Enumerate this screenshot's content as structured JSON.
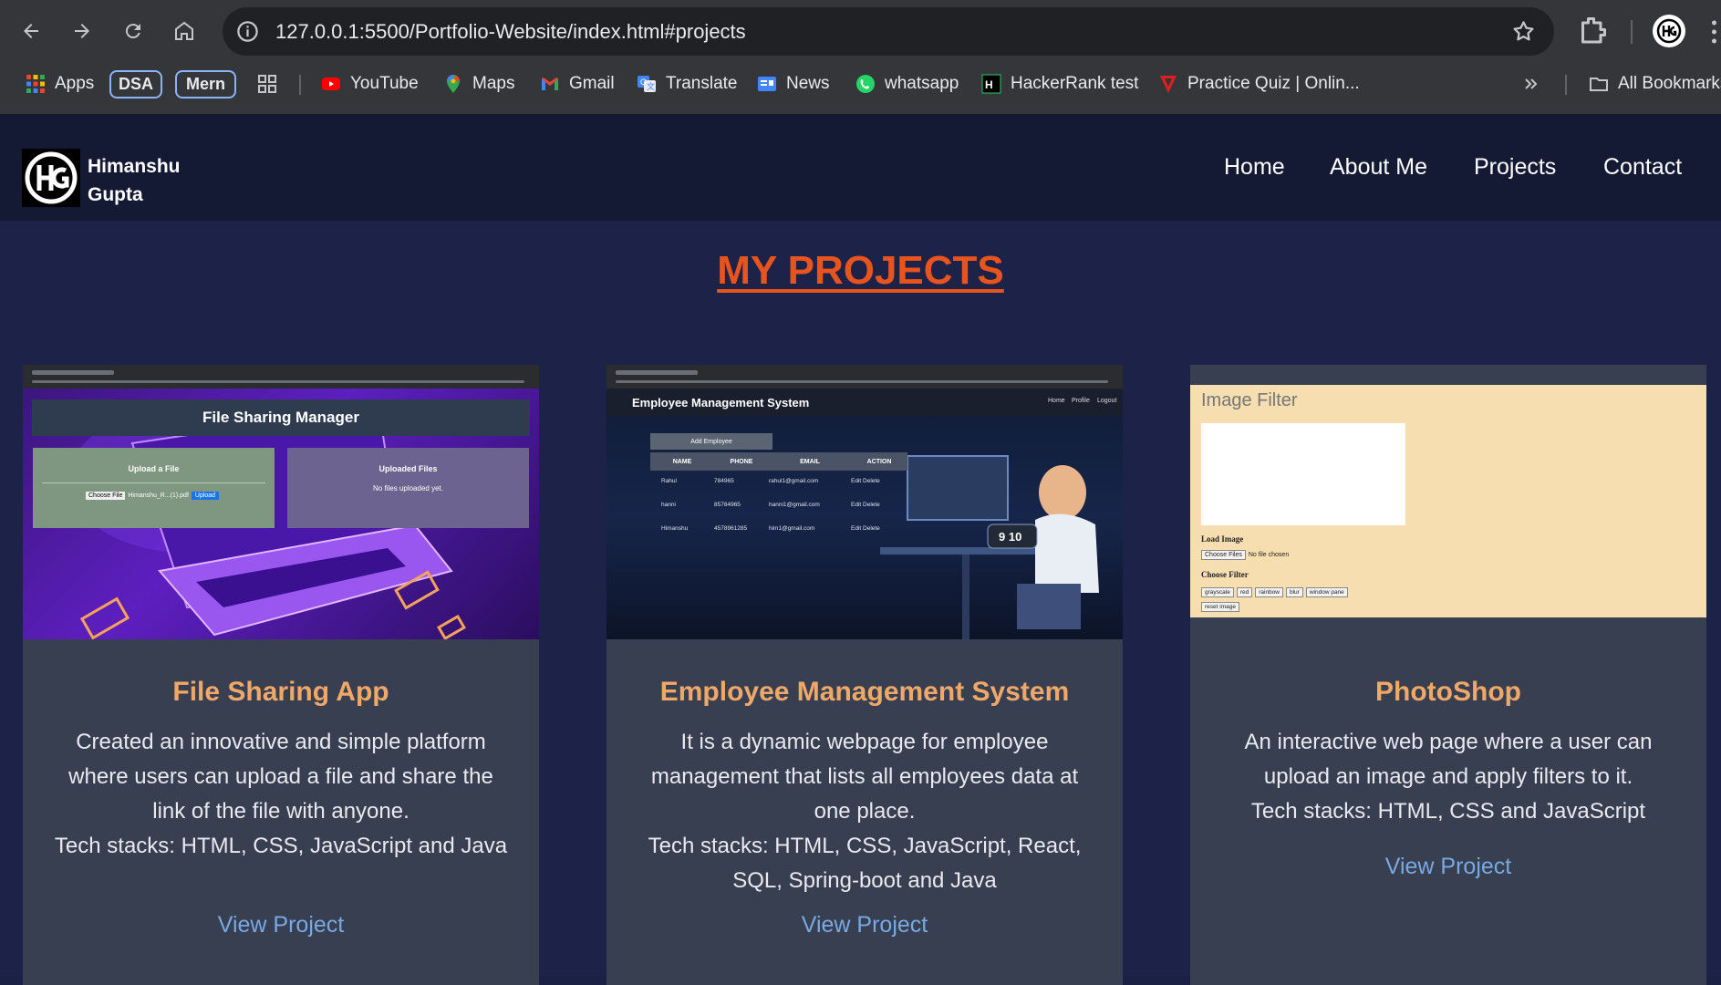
{
  "browser": {
    "url": "127.0.0.1:5500/Portfolio-Website/index.html#projects",
    "bookmarks": [
      {
        "label": "Apps",
        "icon": "apps-grid-icon"
      },
      {
        "label": "DSA",
        "icon": ""
      },
      {
        "label": "Mern",
        "icon": ""
      },
      {
        "label": "",
        "icon": "tab-groups-icon"
      },
      {
        "label": "YouTube",
        "icon": "youtube-icon"
      },
      {
        "label": "Maps",
        "icon": "maps-pin-icon"
      },
      {
        "label": "Gmail",
        "icon": "gmail-icon"
      },
      {
        "label": "Translate",
        "icon": "translate-icon"
      },
      {
        "label": "News",
        "icon": "news-icon"
      },
      {
        "label": "whatsapp",
        "icon": "whatsapp-icon"
      },
      {
        "label": "HackerRank test",
        "icon": "hackerrank-icon"
      },
      {
        "label": "Practice Quiz | Onlin...",
        "icon": "quiz-icon"
      }
    ],
    "all_bookmarks_label": "All Bookmarks"
  },
  "site": {
    "brand_first": "Himanshu",
    "brand_last": "Gupta",
    "nav": [
      "Home",
      "About Me",
      "Projects",
      "Contact"
    ]
  },
  "projects_section": {
    "title": "MY PROJECTS",
    "cards": [
      {
        "title": "File Sharing App",
        "description": "Created an innovative and simple platform where users can upload a file and share the link of the file with anyone.",
        "tech": "Tech stacks: HTML, CSS, JavaScript and Java",
        "link_label": "View Project",
        "thumb": {
          "heading": "File Sharing Manager",
          "upload_title": "Upload a File",
          "choose_label": "Choose File",
          "file_name": "Himanshu_R...(1).pdf",
          "upload_btn": "Upload",
          "uploaded_title": "Uploaded Files",
          "uploaded_empty": "No files uploaded yet."
        }
      },
      {
        "title": "Employee Management System",
        "description": "It is a dynamic webpage for employee management that lists all employees data at one place.",
        "tech": "Tech stacks: HTML, CSS, JavaScript, React, SQL, Spring-boot and Java",
        "link_label": "View Project",
        "thumb": {
          "heading": "Employee Management System",
          "nav": [
            "Home",
            "Profile",
            "Logout"
          ],
          "add_btn": "Add Employee",
          "columns": [
            "NAME",
            "PHONE",
            "EMAIL",
            "ACTION"
          ],
          "rows": [
            [
              "Rahul",
              "784965",
              "rahul1@gmail.com",
              "Edit  Delete"
            ],
            [
              "hanni",
              "85784965",
              "hanni1@gmail.com",
              "Edit  Delete"
            ],
            [
              "Himanshu",
              "4578961285",
              "him1@gmail.com",
              "Edit  Delete"
            ]
          ],
          "clock": "9 10"
        }
      },
      {
        "title": "PhotoShop",
        "description": "An interactive web page where a user can upload an image and apply filters to it.",
        "tech": "Tech stacks: HTML, CSS and JavaScript",
        "link_label": "View Project",
        "thumb": {
          "heading": "Image Filter",
          "load_label": "Load Image",
          "choose_label": "Choose Files",
          "no_file": "No file chosen",
          "filter_label": "Choose Filter",
          "filters": [
            "grayscale",
            "red",
            "rainbow",
            "blur",
            "window pane"
          ],
          "reset": "reset image"
        }
      }
    ]
  },
  "colors": {
    "title_orange": "#e8541e",
    "card_title": "#f0a869",
    "link_blue": "#78a9e3",
    "card_bg": "#383f50",
    "page_bg": "#1d2348"
  }
}
